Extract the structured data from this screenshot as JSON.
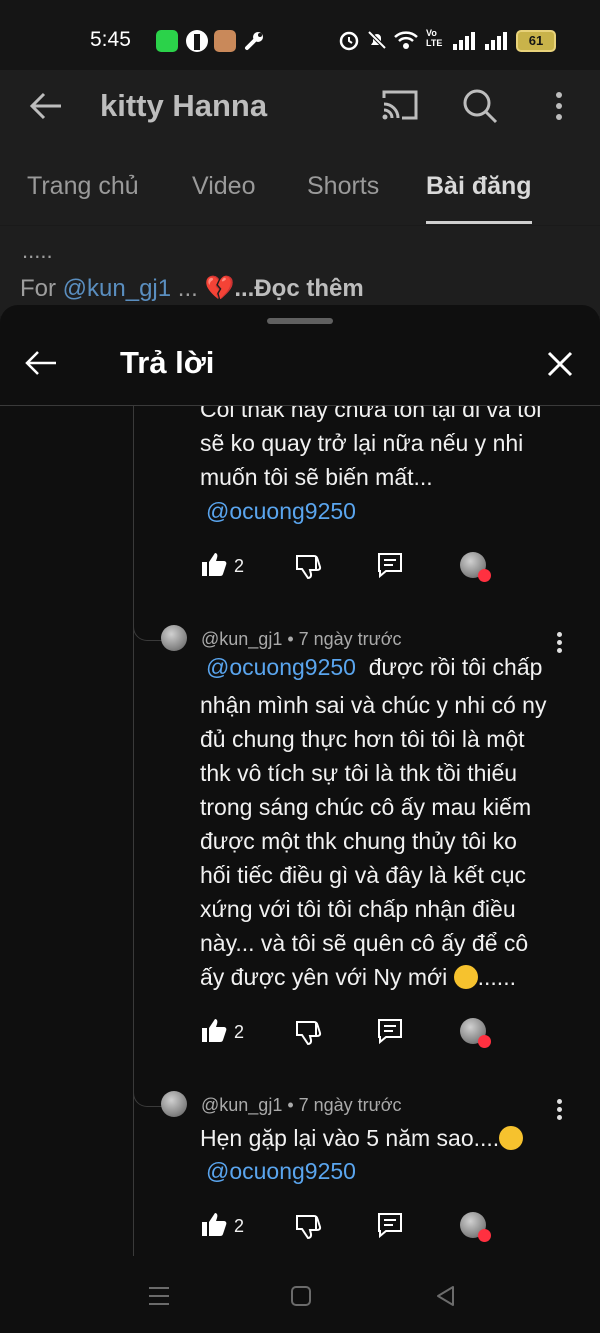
{
  "status_bar": {
    "time": "5:45",
    "battery": "61",
    "volte": "Vo\nLTE"
  },
  "header": {
    "channel_name": "kitty Hanna",
    "icons": [
      "back-arrow-icon",
      "cast-icon",
      "search-icon",
      "more-vertical-icon"
    ]
  },
  "tabs": [
    {
      "label": "Trang chủ",
      "active": false
    },
    {
      "label": "Video",
      "active": false
    },
    {
      "label": "Shorts",
      "active": false
    },
    {
      "label": "Bài đăng",
      "active": true
    }
  ],
  "post_preview": {
    "dots": ".....",
    "prefix": "For ",
    "mention": "@kun_gj1",
    "ellipsis": " ... ",
    "read_more": "...Đọc thêm"
  },
  "sheet": {
    "title": "Trả lời"
  },
  "comments": [
    {
      "body": "Coi thak hay chưa tồn tại đi và tôi\nsẽ ko quay trở lại nữa nếu y nhi\nmuốn tôi sẽ biến mất...",
      "mention": "@ocuong9250",
      "likes": "2"
    },
    {
      "author": "@kun_gj1",
      "separator": " • ",
      "time": "7 ngày trước",
      "mention": "@ocuong9250",
      "body_first": "  được rồi tôi chấp",
      "body": "nhận mình sai và chúc y nhi có ny\nđủ chung thực hơn tôi tôi là một\nthk vô tích sự tôi là thk tồi thiếu\ntrong sáng chúc cô ấy mau kiếm\nđược một thk chung thủy tôi ko\nhối tiếc điều gì và đây là kết cục\nxứng với tôi tôi chấp nhận điều\nnày... và tôi sẽ quên cô ấy để cô",
      "body_last": "ấy được yên với Ny mới ",
      "body_tail": "......",
      "likes": "2"
    },
    {
      "author": "@kun_gj1",
      "separator": " • ",
      "time": "7 ngày trước",
      "body": "Hẹn gặp lại vào 5 năm sao....",
      "mention": "@ocuong9250",
      "likes": "2"
    }
  ],
  "colors": {
    "mention": "#5aa5ee",
    "heart": "#ff3040",
    "background": "#0f0f0f"
  }
}
